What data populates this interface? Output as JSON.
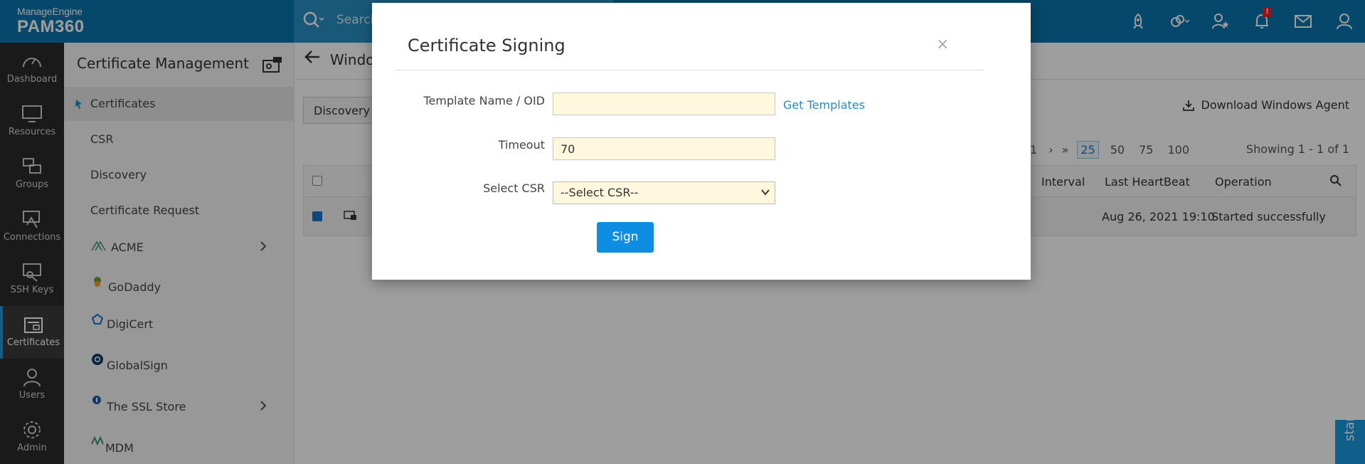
{
  "header": {
    "brand": "ManageEngine",
    "product": "PAM360",
    "search_placeholder": "Search",
    "notification_badge": "!"
  },
  "leftnav": {
    "items": [
      {
        "label": "Dashboard"
      },
      {
        "label": "Resources"
      },
      {
        "label": "Groups"
      },
      {
        "label": "Connections"
      },
      {
        "label": "SSH Keys"
      },
      {
        "label": "Certificates"
      },
      {
        "label": "Users"
      },
      {
        "label": "Admin"
      }
    ]
  },
  "sidebar": {
    "title": "Certificate Management",
    "items": [
      {
        "label": "Certificates"
      },
      {
        "label": "CSR"
      },
      {
        "label": "Discovery"
      },
      {
        "label": "Certificate Request"
      },
      {
        "label": "ACME"
      },
      {
        "label": "GoDaddy"
      },
      {
        "label": "DigiCert"
      },
      {
        "label": "GlobalSign"
      },
      {
        "label": "The SSL Store"
      },
      {
        "label": "MDM"
      }
    ]
  },
  "main": {
    "title": "Windo",
    "tab_discovery": "Discovery",
    "download_agent": "Download Windows Agent",
    "pager": {
      "page": "1",
      "sizes": [
        "25",
        "50",
        "75",
        "100"
      ],
      "selected": "25"
    },
    "showing": "Showing 1 - 1 of 1",
    "columns": [
      "Interval",
      "Last HeartBeat",
      "Operation"
    ],
    "row": {
      "last_heartbeat": "Aug 26, 2021 19:10",
      "operation": "Started successfully"
    }
  },
  "modal": {
    "title": "Certificate Signing",
    "close": "×",
    "template_label": "Template Name / OID",
    "template_value": "",
    "get_templates": "Get Templates",
    "timeout_label": "Timeout",
    "timeout_value": "70",
    "select_csr_label": "Select CSR",
    "select_csr_value": "--Select CSR--",
    "sign_button": "Sign"
  },
  "assist": "stance?"
}
